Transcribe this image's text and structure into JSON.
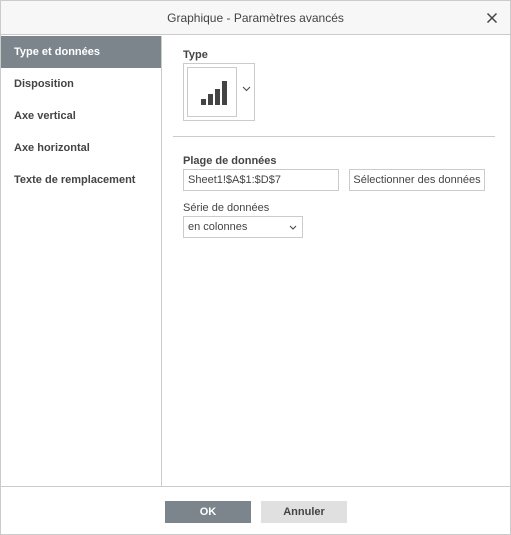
{
  "dialog": {
    "title": "Graphique - Paramètres avancés"
  },
  "sidebar": {
    "items": [
      {
        "label": "Type et données",
        "active": true
      },
      {
        "label": "Disposition",
        "active": false
      },
      {
        "label": "Axe vertical",
        "active": false
      },
      {
        "label": "Axe horizontal",
        "active": false
      },
      {
        "label": "Texte de remplacement",
        "active": false
      }
    ]
  },
  "type_section": {
    "label": "Type",
    "selected_icon": "column-chart-icon"
  },
  "data_range": {
    "label": "Plage de données",
    "value": "Sheet1!$A$1:$D$7",
    "select_button": "Sélectionner des données"
  },
  "series": {
    "label": "Série de données",
    "value": "en colonnes"
  },
  "footer": {
    "ok_label": "OK",
    "cancel_label": "Annuler"
  },
  "colors": {
    "accent": "#7d858c",
    "border": "#cbcbcb",
    "text": "#444444"
  }
}
